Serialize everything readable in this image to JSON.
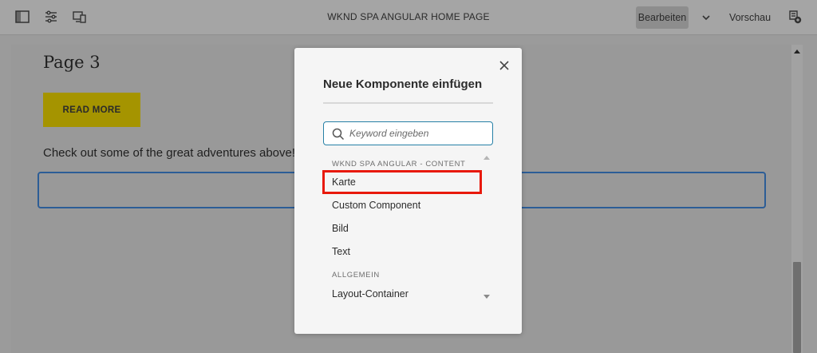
{
  "toolbar": {
    "title": "WKND SPA ANGULAR HOME PAGE",
    "edit_label": "Bearbeiten",
    "preview_label": "Vorschau",
    "icons": [
      "sidebar-toggle-icon",
      "page-properties-icon",
      "emulator-icon",
      "chevron-down-icon",
      "annotations-icon"
    ]
  },
  "page": {
    "title": "Page 3",
    "read_more_label": "READ MORE",
    "body_text": "Check out some of the great adventures above!"
  },
  "modal": {
    "title": "Neue Komponente einfügen",
    "search_placeholder": "Keyword eingeben",
    "groups": [
      {
        "name": "WKND SPA ANGULAR - CONTENT",
        "items": [
          "Karte",
          "Custom Component",
          "Bild",
          "Text"
        ]
      },
      {
        "name": "ALLGEMEIN",
        "items": [
          "Layout-Container"
        ]
      }
    ],
    "selected_item": "Karte"
  },
  "colors": {
    "accent_blue": "#2c5d96",
    "highlight_red": "#e8190b",
    "button_yellow": "#a59400"
  }
}
